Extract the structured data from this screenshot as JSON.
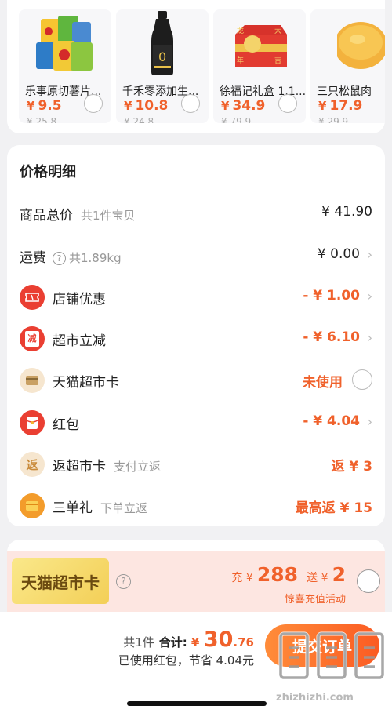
{
  "recommend": {
    "items": [
      {
        "name": "乐事原切薯片...",
        "price": "9.5",
        "currency": "¥",
        "orig_price": "¥ 25.8",
        "image": "chips-bag"
      },
      {
        "name": "千禾零添加生...",
        "price": "10.8",
        "currency": "¥",
        "orig_price": "¥ 24.8",
        "image": "soy-sauce-bottle"
      },
      {
        "name": "徐福记礼盒 1.1...",
        "price": "34.9",
        "currency": "¥",
        "orig_price": "¥ 79.9",
        "image": "gift-box",
        "image_text": [
          "龙",
          "大",
          "年",
          "吉"
        ]
      },
      {
        "name": "三只松鼠肉",
        "price": "17.9",
        "currency": "¥",
        "orig_price": "¥ 29.9",
        "image": "mooncake"
      }
    ]
  },
  "price_detail": {
    "title": "价格明细",
    "rows": [
      {
        "label": "商品总价",
        "sub": "共1件宝贝",
        "value": "¥ 41.90"
      },
      {
        "label": "运费",
        "help": "?",
        "sub": "共1.89kg",
        "value": "¥ 0.00",
        "arrow": "›"
      },
      {
        "label": "店铺优惠",
        "value": "- ¥ 1.00",
        "arrow": "›",
        "icon": "ticket-icon"
      },
      {
        "label": "超市立减",
        "value": "- ¥ 6.10",
        "arrow": "›",
        "icon": "reduce-icon",
        "icon_text": "减"
      },
      {
        "label": "天猫超市卡",
        "value": "未使用",
        "icon": "card-icon"
      },
      {
        "label": "红包",
        "value": "- ¥ 4.04",
        "arrow": "›",
        "icon": "red-packet-icon"
      },
      {
        "label": "返超市卡",
        "sub": "支付立返",
        "value": "返 ¥ 3",
        "icon": "return-icon",
        "icon_text": "返"
      },
      {
        "label": "三单礼",
        "sub": "下单立返",
        "value": "最高返 ¥ 15",
        "icon": "gift-card-icon"
      }
    ]
  },
  "tmall_card": {
    "badge": "天猫超市卡",
    "help": "?",
    "offer_prefix": "充 ¥",
    "offer_amount": "288",
    "offer_mid": "送 ¥",
    "offer_gift": "2",
    "sub": "惊喜充值活动"
  },
  "bottom": {
    "count": "共1件",
    "total_label": "合计:",
    "total_currency": "¥",
    "total_int": "30",
    "total_dec": ".76",
    "saving": "已使用红包，节省 4.04元",
    "submit": "提交订单",
    "watermark": "zhizhizhi.com"
  },
  "colors": {
    "accent": "#f0612b",
    "red_icon": "#ea3f32",
    "card_banner": "#fde6e1"
  }
}
